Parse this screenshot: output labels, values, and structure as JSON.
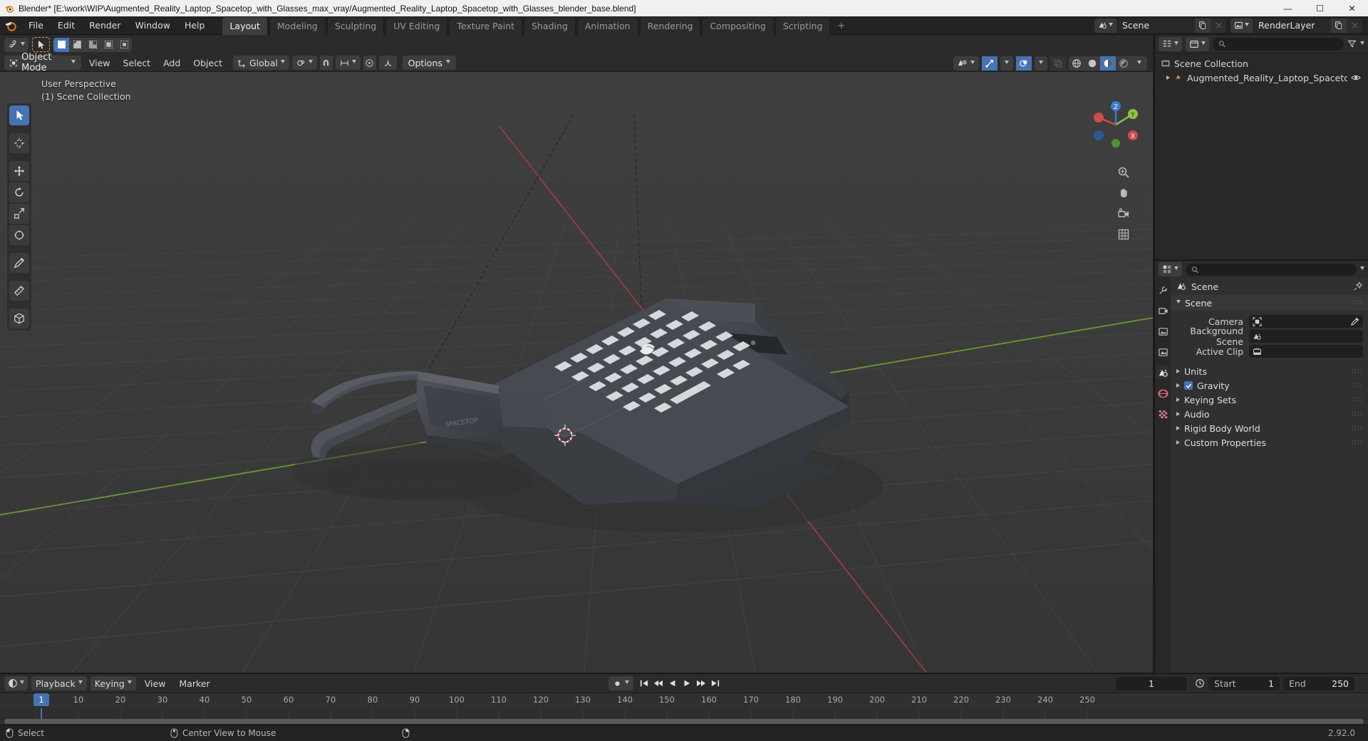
{
  "window": {
    "title": "Blender* [E:\\work\\WIP\\Augmented_Reality_Laptop_Spacetop_with_Glasses_max_vray/Augmented_Reality_Laptop_Spacetop_with_Glasses_blender_base.blend]",
    "minimize": "—",
    "maximize": "☐",
    "close": "✕"
  },
  "topbar": {
    "menus": [
      "File",
      "Edit",
      "Render",
      "Window",
      "Help"
    ],
    "workspaces": [
      {
        "label": "Layout",
        "active": true
      },
      {
        "label": "Modeling",
        "active": false
      },
      {
        "label": "Sculpting",
        "active": false
      },
      {
        "label": "UV Editing",
        "active": false
      },
      {
        "label": "Texture Paint",
        "active": false
      },
      {
        "label": "Shading",
        "active": false
      },
      {
        "label": "Animation",
        "active": false
      },
      {
        "label": "Rendering",
        "active": false
      },
      {
        "label": "Compositing",
        "active": false
      },
      {
        "label": "Scripting",
        "active": false
      }
    ],
    "workspace_add": "+",
    "scene_name": "Scene",
    "view_layer_name": "RenderLayer"
  },
  "viewport": {
    "mode": "Object Mode",
    "menus": [
      "View",
      "Select",
      "Add",
      "Object"
    ],
    "transform_orientation": "Global",
    "options_label": "Options",
    "overlay_line1": "User Perspective",
    "overlay_line2": "(1) Scene Collection",
    "tools": [
      "tweak-select-tool",
      "cursor-tool",
      "move-tool",
      "rotate-tool",
      "scale-tool",
      "transform-tool",
      "annotate-tool",
      "measure-tool",
      "add-cube-tool"
    ],
    "nav_buttons": [
      "zoom-icon",
      "hand-pan-icon",
      "camera-view-icon",
      "toggle-orthographic-icon"
    ],
    "gizmo_axes": [
      "X",
      "Y",
      "Z"
    ]
  },
  "outliner": {
    "search_placeholder": "",
    "rows": [
      {
        "label": "Scene Collection",
        "indent": 0,
        "icon": "collection-icon",
        "expandable": false
      },
      {
        "label": "Augmented_Reality_Laptop_Spacetop_with_",
        "indent": 1,
        "icon": "armature-icon",
        "expandable": true
      }
    ]
  },
  "properties": {
    "search_placeholder": "",
    "breadcrumb": "Scene",
    "tabs": [
      {
        "name": "tool-tab",
        "active": false
      },
      {
        "name": "render-tab",
        "active": false
      },
      {
        "name": "output-tab",
        "active": false
      },
      {
        "name": "view-layer-tab",
        "active": false
      },
      {
        "name": "scene-tab",
        "active": true
      },
      {
        "name": "world-tab",
        "active": false
      },
      {
        "name": "texture-tab",
        "active": false
      }
    ],
    "panel_title": "Scene",
    "fields": [
      {
        "label": "Camera",
        "value": "",
        "icon": "camera-data-icon",
        "eyedropper": true
      },
      {
        "label": "Background Scene",
        "value": "",
        "icon": "scene-icon",
        "eyedropper": false
      },
      {
        "label": "Active Clip",
        "value": "",
        "icon": "clip-icon",
        "eyedropper": false
      }
    ],
    "sections": [
      {
        "label": "Units",
        "checkbox": false,
        "checked": false
      },
      {
        "label": "Gravity",
        "checkbox": true,
        "checked": true
      },
      {
        "label": "Keying Sets",
        "checkbox": false,
        "checked": false
      },
      {
        "label": "Audio",
        "checkbox": false,
        "checked": false
      },
      {
        "label": "Rigid Body World",
        "checkbox": false,
        "checked": false
      },
      {
        "label": "Custom Properties",
        "checkbox": false,
        "checked": false
      }
    ]
  },
  "timeline": {
    "menus": [
      "Playback",
      "Keying",
      "View",
      "Marker"
    ],
    "current_frame": "1",
    "start_label": "Start",
    "start_value": "1",
    "end_label": "End",
    "end_value": "250",
    "ticks": [
      "10",
      "20",
      "30",
      "40",
      "50",
      "60",
      "70",
      "80",
      "90",
      "100",
      "110",
      "120",
      "130",
      "140",
      "150",
      "160",
      "170",
      "180",
      "190",
      "200",
      "210",
      "220",
      "230",
      "240",
      "250"
    ],
    "playhead_label": "1"
  },
  "statusbar": {
    "items": [
      {
        "icon": "mouse-left-icon",
        "label": "Select"
      },
      {
        "icon": "mouse-middle-icon",
        "label": "Center View to Mouse"
      },
      {
        "icon": "mouse-right-icon",
        "label": ""
      }
    ],
    "version": "2.92.0"
  },
  "colors": {
    "accent_blue": "#4772b3",
    "tool_orange": "#e8a33d",
    "viewport_bg": "#3b3b3b",
    "panel_bg": "#303030",
    "header_bg": "#2b2b2b",
    "axis_x_red": "#c4484f",
    "axis_y_green": "#7fb539"
  }
}
